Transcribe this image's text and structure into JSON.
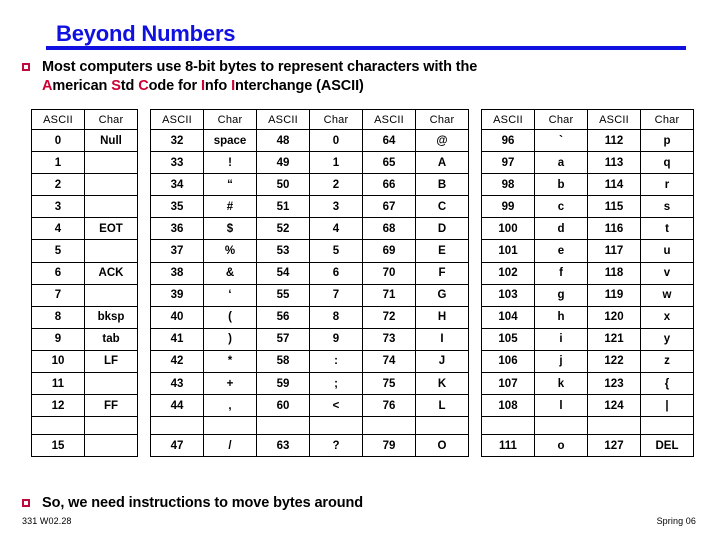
{
  "slide": {
    "title": "Beyond Numbers",
    "title_color": "#1010E0",
    "bullet_color": "#BE0A3C",
    "highlight_color": "#CC0033"
  },
  "bullets": {
    "top": {
      "line1": "Most computers use 8-bit bytes to represent characters with the",
      "line2_parts": [
        {
          "text": "A",
          "highlight": true
        },
        {
          "text": "merican ",
          "highlight": false
        },
        {
          "text": "S",
          "highlight": true
        },
        {
          "text": "td ",
          "highlight": false
        },
        {
          "text": "C",
          "highlight": true
        },
        {
          "text": "ode for ",
          "highlight": false
        },
        {
          "text": "I",
          "highlight": true
        },
        {
          "text": "nfo ",
          "highlight": false
        },
        {
          "text": "I",
          "highlight": true
        },
        {
          "text": "nterchange (ASCII)",
          "highlight": false
        }
      ]
    },
    "bottom": {
      "text": "So, we need instructions to move bytes around"
    }
  },
  "table": {
    "headers": [
      "ASCII",
      "Char"
    ],
    "group_count": 6,
    "spacer_after_groups": [
      1,
      4
    ],
    "groups": [
      {
        "rows": [
          [
            "0",
            "Null"
          ],
          [
            "1",
            ""
          ],
          [
            "2",
            ""
          ],
          [
            "3",
            ""
          ],
          [
            "4",
            "EOT"
          ],
          [
            "5",
            ""
          ],
          [
            "6",
            "ACK"
          ],
          [
            "7",
            ""
          ],
          [
            "8",
            "bksp"
          ],
          [
            "9",
            "tab"
          ],
          [
            "10",
            "LF"
          ],
          [
            "11",
            ""
          ],
          [
            "12",
            "FF"
          ],
          [
            "",
            ""
          ],
          [
            "15",
            ""
          ]
        ]
      },
      {
        "rows": [
          [
            "32",
            "space"
          ],
          [
            "33",
            "!"
          ],
          [
            "34",
            "“"
          ],
          [
            "35",
            "#"
          ],
          [
            "36",
            "$"
          ],
          [
            "37",
            "%"
          ],
          [
            "38",
            "&"
          ],
          [
            "39",
            "‘"
          ],
          [
            "40",
            "("
          ],
          [
            "41",
            ")"
          ],
          [
            "42",
            "*"
          ],
          [
            "43",
            "+"
          ],
          [
            "44",
            ","
          ],
          [
            "",
            ""
          ],
          [
            "47",
            "/"
          ]
        ]
      },
      {
        "rows": [
          [
            "48",
            "0"
          ],
          [
            "49",
            "1"
          ],
          [
            "50",
            "2"
          ],
          [
            "51",
            "3"
          ],
          [
            "52",
            "4"
          ],
          [
            "53",
            "5"
          ],
          [
            "54",
            "6"
          ],
          [
            "55",
            "7"
          ],
          [
            "56",
            "8"
          ],
          [
            "57",
            "9"
          ],
          [
            "58",
            ":"
          ],
          [
            "59",
            ";"
          ],
          [
            "60",
            "<"
          ],
          [
            "",
            ""
          ],
          [
            "63",
            "?"
          ]
        ]
      },
      {
        "rows": [
          [
            "64",
            "@"
          ],
          [
            "65",
            "A"
          ],
          [
            "66",
            "B"
          ],
          [
            "67",
            "C"
          ],
          [
            "68",
            "D"
          ],
          [
            "69",
            "E"
          ],
          [
            "70",
            "F"
          ],
          [
            "71",
            "G"
          ],
          [
            "72",
            "H"
          ],
          [
            "73",
            "I"
          ],
          [
            "74",
            "J"
          ],
          [
            "75",
            "K"
          ],
          [
            "76",
            "L"
          ],
          [
            "",
            ""
          ],
          [
            "79",
            "O"
          ]
        ]
      },
      {
        "rows": [
          [
            "96",
            "`"
          ],
          [
            "97",
            "a"
          ],
          [
            "98",
            "b"
          ],
          [
            "99",
            "c"
          ],
          [
            "100",
            "d"
          ],
          [
            "101",
            "e"
          ],
          [
            "102",
            "f"
          ],
          [
            "103",
            "g"
          ],
          [
            "104",
            "h"
          ],
          [
            "105",
            "i"
          ],
          [
            "106",
            "j"
          ],
          [
            "107",
            "k"
          ],
          [
            "108",
            "l"
          ],
          [
            "",
            ""
          ],
          [
            "111",
            "o"
          ]
        ]
      },
      {
        "rows": [
          [
            "112",
            "p"
          ],
          [
            "113",
            "q"
          ],
          [
            "114",
            "r"
          ],
          [
            "115",
            "s"
          ],
          [
            "116",
            "t"
          ],
          [
            "117",
            "u"
          ],
          [
            "118",
            "v"
          ],
          [
            "119",
            "w"
          ],
          [
            "120",
            "x"
          ],
          [
            "121",
            "y"
          ],
          [
            "122",
            "z"
          ],
          [
            "123",
            "{"
          ],
          [
            "124",
            "|"
          ],
          [
            "",
            ""
          ],
          [
            "127",
            "DEL"
          ]
        ]
      }
    ],
    "gap_row_index": 13
  },
  "footer": {
    "left": "331  W02.28",
    "right": "Spring 06"
  }
}
